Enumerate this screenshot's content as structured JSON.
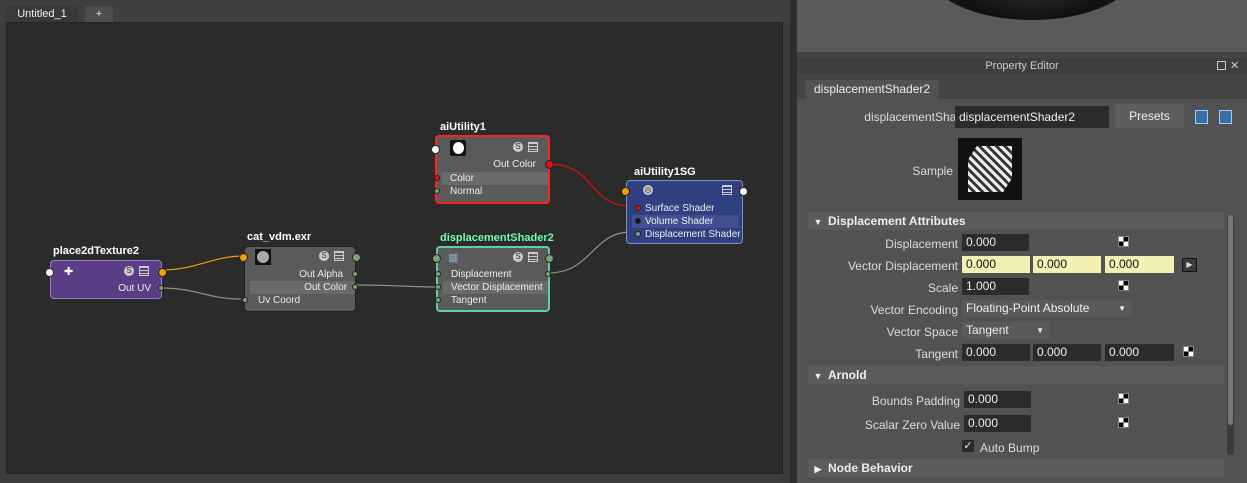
{
  "tabs": [
    {
      "label": "Untitled_1"
    },
    {
      "label": "+"
    }
  ],
  "nodes": {
    "aiutility1": {
      "title": "aiUtility1",
      "out_color": "Out Color",
      "attrs": [
        "Color",
        "Normal"
      ]
    },
    "aiutility1sg": {
      "title": "aiUtility1SG",
      "attrs": [
        "Surface Shader",
        "Volume Shader",
        "Displacement Shader"
      ]
    },
    "place2d": {
      "title": "place2dTexture2",
      "out_uv": "Out UV"
    },
    "cat": {
      "title": "cat_vdm.exr",
      "out_alpha": "Out Alpha",
      "out_color": "Out Color",
      "uv_coord": "Uv Coord"
    },
    "disp": {
      "title": "displacementShader2",
      "attrs": [
        "Displacement",
        "Vector Displacement",
        "Tangent"
      ]
    }
  },
  "property_editor": {
    "title": "Property Editor",
    "tab": "displacementShader2",
    "node_label": "displacementShader:",
    "node_value": "displacementShader2",
    "presets_label": "Presets",
    "sample_label": "Sample",
    "sections": {
      "displacement_attrs": "Displacement Attributes",
      "arnold": "Arnold",
      "node_behavior": "Node Behavior"
    },
    "fields": {
      "displacement": {
        "label": "Displacement",
        "value": "0.000"
      },
      "vector_displacement": {
        "label": "Vector Displacement",
        "values": [
          "0.000",
          "0.000",
          "0.000"
        ]
      },
      "scale": {
        "label": "Scale",
        "value": "1.000"
      },
      "vector_encoding": {
        "label": "Vector Encoding",
        "value": "Floating-Point Absolute"
      },
      "vector_space": {
        "label": "Vector Space",
        "value": "Tangent"
      },
      "tangent": {
        "label": "Tangent",
        "values": [
          "0.000",
          "0.000",
          "0.000"
        ]
      },
      "bounds_padding": {
        "label": "Bounds Padding",
        "value": "0.000"
      },
      "scalar_zero_value": {
        "label": "Scalar Zero Value",
        "value": "0.000"
      },
      "auto_bump": {
        "label": "Auto Bump",
        "checked": true
      }
    }
  },
  "colors": {
    "aiutility_border": "#ff2020",
    "sg_body": "#2f3f7f",
    "place2d_body": "#5b3d85",
    "disp_border": "#5fd0a0",
    "disp_title": "#6fffb0",
    "link_orange": "#f2a000",
    "link_red": "#e01010",
    "link_green": "#7f9a7a",
    "port_green": "#7fa06f"
  }
}
